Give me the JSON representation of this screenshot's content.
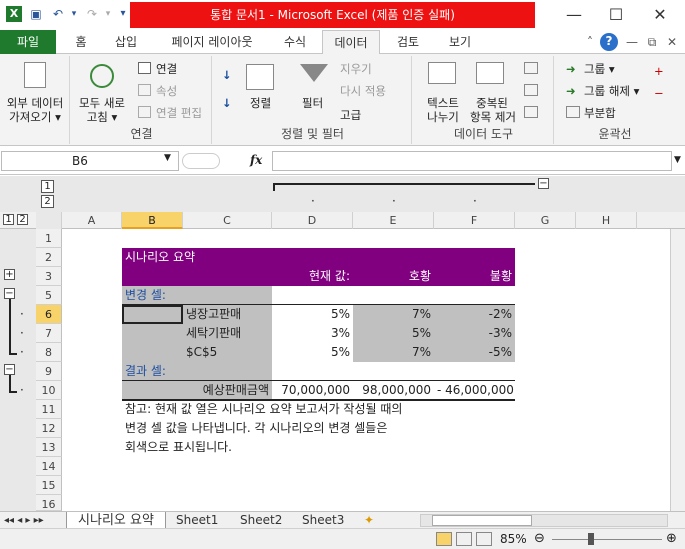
{
  "title_bar": {
    "title": "통합 문서1 - Microsoft Excel (제품 인증 실패)",
    "min": "—",
    "max": "☐",
    "close": "✕"
  },
  "ribbon_tabs": [
    "파일",
    "홈",
    "삽입",
    "페이지 레이아웃",
    "수식",
    "데이터",
    "검토",
    "보기"
  ],
  "ribbon": {
    "external_data": "외부 데이터\n가져오기 ▾",
    "refresh_all": "모두 새로\n고침 ▾",
    "connections": "연결",
    "properties": "속성",
    "edit_links": "연결 편집",
    "group_connections": "연결",
    "sort_asc": "",
    "sort": "정렬",
    "filter": "필터",
    "clear": "지우기",
    "reapply": "다시 적용",
    "advanced": "고급",
    "group_sort": "정렬 및 필터",
    "text_to_cols": "텍스트\n나누기",
    "remove_dup": "중복된\n항목 제거",
    "group_tools": "데이터 도구",
    "group": "그룹 ▾",
    "ungroup": "그룹 해제 ▾",
    "subtotal": "부분합",
    "group_outline": "윤곽선"
  },
  "formula_bar": {
    "name_box": "B6",
    "fx": "fx",
    "value": ""
  },
  "columns": [
    "A",
    "B",
    "C",
    "D",
    "E",
    "F",
    "G",
    "H"
  ],
  "rows": [
    "1",
    "2",
    "3",
    "5",
    "6",
    "7",
    "8",
    "9",
    "10",
    "11",
    "12",
    "13",
    "14",
    "15",
    "16"
  ],
  "scenario": {
    "title": "시나리오 요약",
    "header": {
      "current": "현재 값:",
      "col2": "호황",
      "col3": "불황"
    },
    "changing_label": "변경 셀:",
    "changing": [
      {
        "name": "냉장고판매",
        "current": "5%",
        "v2": "7%",
        "v3": "-2%"
      },
      {
        "name": "세탁기판매",
        "current": "3%",
        "v2": "5%",
        "v3": "-3%"
      },
      {
        "name": "$C$5",
        "current": "5%",
        "v2": "7%",
        "v3": "-5%"
      }
    ],
    "result_label": "결과 셀:",
    "result": {
      "name": "예상판매금액",
      "current": "70,000,000",
      "v2": "98,000,000",
      "v3": "- 46,000,000"
    },
    "note1": "참고: 현재 값 열은 시나리오 요약 보고서가 작성될 때의",
    "note2": "변경 셀 값을 나타냅니다. 각 시나리오의 변경 셀들은",
    "note3": "회색으로 표시됩니다."
  },
  "sheets": [
    "시나리오 요약",
    "Sheet1",
    "Sheet2",
    "Sheet3"
  ],
  "status": {
    "zoom": "85%"
  },
  "colors": {
    "title_red": "#ee1111",
    "file_tab": "#1f7a2e",
    "header_purple": "#800080",
    "gray_cell": "#c0c0c0",
    "selected_hdr": "#f8d36a"
  }
}
